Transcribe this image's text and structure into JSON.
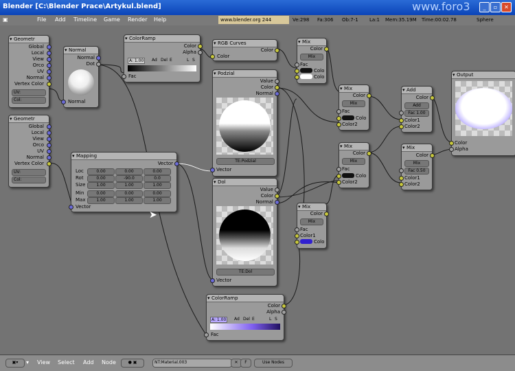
{
  "window": {
    "title": "Blender [C:\\Blender Prace\\Artykul.blend]",
    "watermark": "www.foro3"
  },
  "menu": [
    "File",
    "Add",
    "Timeline",
    "Game",
    "Render",
    "Help"
  ],
  "info": {
    "url": "www.blender.org 244",
    "ve": "Ve:298",
    "fa": "Fa:306",
    "ob": "Ob:7-1",
    "la": "La:1",
    "mem": "Mem:35.19M",
    "time": "Time:00:02.78",
    "scene": "Sphere"
  },
  "nodes": {
    "geo1": {
      "title": "Geometr",
      "outs": [
        "Global",
        "Local",
        "View",
        "Orco",
        "UV",
        "Normal",
        "Vertex Color"
      ],
      "uv": "UV:",
      "col": "Col:"
    },
    "geo2": {
      "title": "Geometr",
      "outs": [
        "Global",
        "Local",
        "View",
        "Orco",
        "UV",
        "Normal",
        "Vertex Color"
      ],
      "uv": "UV:",
      "col": "Col:"
    },
    "normal": {
      "title": "Normal",
      "outs": [
        "Normal",
        "Dot"
      ],
      "in": "Normal"
    },
    "colorramp1": {
      "title": "ColorRamp",
      "outs": [
        "Color",
        "Alpha"
      ],
      "in": "Fac",
      "ctrl": [
        "A: 1.00",
        "Ad",
        "Del",
        "E",
        "L",
        "S"
      ]
    },
    "rgbcurves": {
      "title": "RGB Curves",
      "outs": [
        "Color"
      ],
      "in": "Color"
    },
    "mix1": {
      "title": "Mix",
      "outs": [
        "Color"
      ],
      "mode": "Mix",
      "ins": [
        "Fac",
        "Colo",
        "Colo"
      ]
    },
    "podzial": {
      "title": "Podzial",
      "outs": [
        "Value",
        "Color",
        "Normal"
      ],
      "tex": "TE:Podzial",
      "in": "Vector"
    },
    "mix2": {
      "title": "Mix",
      "outs": [
        "Color"
      ],
      "mode": "Mix",
      "ins": [
        "Fac",
        "Colo",
        "Color2"
      ]
    },
    "add": {
      "title": "Add",
      "outs": [
        "Color"
      ],
      "mode": "Add",
      "fac": "Fac 1.00",
      "ins": [
        "Color1",
        "Color2"
      ]
    },
    "output": {
      "title": "Output",
      "ins": [
        "Color",
        "Alpha"
      ]
    },
    "mapping": {
      "title": "Mapping",
      "outs": [
        "Vector"
      ],
      "in": "Vector",
      "rows": [
        {
          "label": "Loc",
          "v": [
            "0.00",
            "0.00",
            "0.00"
          ]
        },
        {
          "label": "Rot",
          "v": [
            "0.00",
            "-90.0",
            "0.0"
          ]
        },
        {
          "label": "Size",
          "v": [
            "1.00",
            "1.00",
            "1.00"
          ]
        },
        {
          "label": "Min",
          "v": [
            "0.00",
            "0.00",
            "0.00"
          ]
        },
        {
          "label": "Max",
          "v": [
            "1.00",
            "1.00",
            "1.00"
          ]
        }
      ]
    },
    "mix3": {
      "title": "Mix",
      "outs": [
        "Color"
      ],
      "mode": "Mix",
      "ins": [
        "Fac",
        "Colo",
        "Color2"
      ]
    },
    "mix4": {
      "title": "Mix",
      "outs": [
        "Color"
      ],
      "mode": "Mix",
      "fac": "Fac 0.50",
      "ins": [
        "Color1",
        "Color2"
      ]
    },
    "dol": {
      "title": "Dol",
      "outs": [
        "Value",
        "Color",
        "Normal"
      ],
      "tex": "TE:Dol",
      "in": "Vector"
    },
    "mix5": {
      "title": "Mix",
      "outs": [
        "Color"
      ],
      "mode": "Mix",
      "ins": [
        "Fac",
        "Color1",
        "Colo"
      ]
    },
    "colorramp2": {
      "title": "ColorRamp",
      "outs": [
        "Color",
        "Alpha"
      ],
      "in": "Fac",
      "ctrl": [
        "A: 1.00",
        "Ad",
        "Del",
        "E",
        "L",
        "S"
      ]
    }
  },
  "footer": {
    "view": "View",
    "select": "Select",
    "add": "Add",
    "node": "Node",
    "material": "NT:Material.003",
    "f": "F",
    "use_nodes": "Use Nodes"
  }
}
